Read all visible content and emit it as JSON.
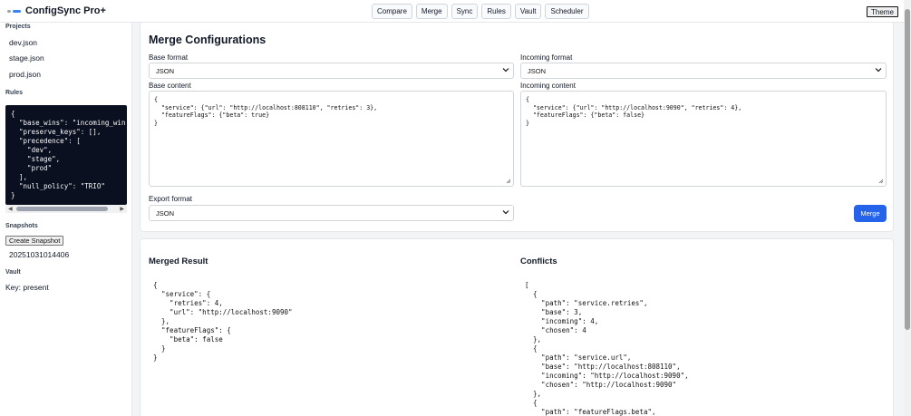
{
  "app": {
    "title": "ConfigSync Pro+"
  },
  "nav": {
    "items": [
      "Compare",
      "Merge",
      "Sync",
      "Rules",
      "Vault",
      "Scheduler"
    ],
    "theme_label": "Theme"
  },
  "sidebar": {
    "projects_heading": "Projects",
    "projects": [
      "dev.json",
      "stage.json",
      "prod.json"
    ],
    "rules_heading": "Rules",
    "rules_json": "{\n  \"base_wins\": \"incoming_win\n  \"preserve_keys\": [],\n  \"precedence\": [\n    \"dev\",\n    \"stage\",\n    \"prod\"\n  ],\n  \"null_policy\": \"TRIO\"\n}",
    "snapshots_heading": "Snapshots",
    "create_snapshot_label": "Create Snapshot",
    "snapshot_id": "20251031014406",
    "vault_heading": "Vault",
    "vault_status": "Key: present"
  },
  "merge_panel": {
    "title": "Merge Configurations",
    "base_format_label": "Base format",
    "base_format_value": "JSON",
    "incoming_format_label": "Incoming format",
    "incoming_format_value": "JSON",
    "base_content_label": "Base content",
    "base_content": "{\n  \"service\": {\"url\": \"http://localhost:808110\", \"retries\": 3},\n  \"featureFlags\": {\"beta\": true}\n}",
    "incoming_content_label": "Incoming content",
    "incoming_content": "{\n  \"service\": {\"url\": \"http://localhost:9090\", \"retries\": 4},\n  \"featureFlags\": {\"beta\": false}\n}",
    "export_format_label": "Export format",
    "export_format_value": "JSON",
    "merge_button_label": "Merge"
  },
  "results_panel": {
    "merged_title": "Merged Result",
    "merged_json": "{\n  \"service\": {\n    \"retries\": 4,\n    \"url\": \"http://localhost:9090\"\n  },\n  \"featureFlags\": {\n    \"beta\": false\n  }\n}",
    "conflicts_title": "Conflicts",
    "conflicts_json": "[\n  {\n    \"path\": \"service.retries\",\n    \"base\": 3,\n    \"incoming\": 4,\n    \"chosen\": 4\n  },\n  {\n    \"path\": \"service.url\",\n    \"base\": \"http://localhost:808110\",\n    \"incoming\": \"http://localhost:9090\",\n    \"chosen\": \"http://localhost:9090\"\n  },\n  {\n    \"path\": \"featureFlags.beta\","
  },
  "colors": {
    "accent": "#2563eb",
    "code_bg": "#0b1020",
    "logo_a": "#9ca3af",
    "logo_b": "#3b82f6"
  }
}
